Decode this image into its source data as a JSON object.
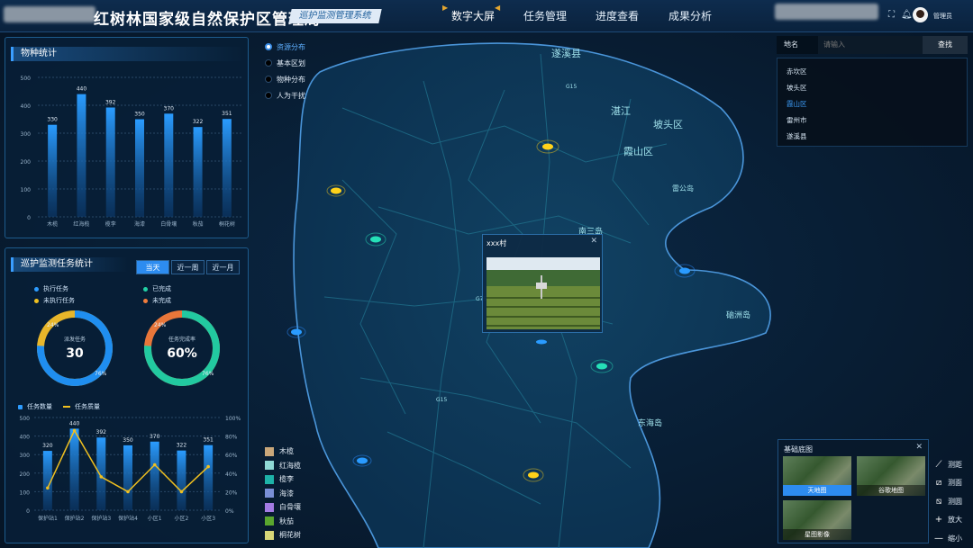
{
  "header": {
    "app_title": "红树林国家级自然保护区管理局",
    "system_badge": "巡护监测管理系统",
    "nav": [
      "数字大屏",
      "任务管理",
      "进度查看",
      "成果分析"
    ],
    "user_name": "管理员"
  },
  "species_panel": {
    "title": "物种统计",
    "chart_data": {
      "type": "bar",
      "categories": [
        "木榄",
        "红海榄",
        "榄李",
        "海漆",
        "白骨壤",
        "秋茄",
        "桐花树"
      ],
      "values": [
        330,
        440,
        392,
        350,
        370,
        322,
        351
      ],
      "ylim": [
        0,
        500
      ],
      "yticks": [
        "0",
        "100",
        "200",
        "300",
        "400",
        "500"
      ]
    }
  },
  "patrol_panel": {
    "title": "巡护监测任务统计",
    "tabs": [
      "当天",
      "近一周",
      "近一月"
    ],
    "legend1": [
      "执行任务",
      "未执行任务"
    ],
    "legend2": [
      "已完成",
      "未完成"
    ],
    "donut1": {
      "label": "派发任务",
      "value": "30",
      "pct_a": "24%",
      "pct_b": "76%",
      "fraction": 0.76
    },
    "donut2": {
      "label": "任务完成率",
      "value": "60%",
      "pct_a": "24%",
      "pct_b": "76%",
      "fraction": 0.76
    },
    "legend3": [
      "任务数量",
      "任务质量"
    ],
    "chart_data": {
      "type": "bar",
      "categories": [
        "保护站1",
        "保护站2",
        "保护站3",
        "保护站4",
        "小区1",
        "小区2",
        "小区3"
      ],
      "series": [
        {
          "name": "任务数量",
          "values": [
            320,
            440,
            392,
            350,
            370,
            322,
            351
          ]
        },
        {
          "name": "任务质量",
          "values": [
            24,
            86,
            36,
            20,
            49,
            20,
            47
          ]
        }
      ],
      "labels": [
        "320",
        "440",
        "392",
        "350",
        "370",
        "322",
        "351"
      ],
      "yticks_left": [
        "0",
        "100",
        "200",
        "300",
        "400",
        "500"
      ],
      "yticks_right": [
        "0%",
        "20%",
        "40%",
        "60%",
        "80%",
        "100%"
      ]
    }
  },
  "resource_menu": [
    "资源分布",
    "基本区划",
    "物种分布",
    "人为干扰"
  ],
  "search": {
    "label": "地名",
    "placeholder": "请输入",
    "button": "查找"
  },
  "districts": [
    "赤坎区",
    "坡头区",
    "霞山区",
    "雷州市",
    "遂溪县"
  ],
  "species_legend": [
    {
      "name": "木榄",
      "color": "#c9a77a"
    },
    {
      "name": "红海榄",
      "color": "#8fd9d6"
    },
    {
      "name": "榄李",
      "color": "#1eb3a8"
    },
    {
      "name": "海漆",
      "color": "#7a8fd6"
    },
    {
      "name": "白骨壤",
      "color": "#a47be3"
    },
    {
      "name": "秋茄",
      "color": "#5aa62e"
    },
    {
      "name": "桐花树",
      "color": "#d6d678"
    }
  ],
  "map_labels": [
    "遂溪县",
    "湛江",
    "坡头区",
    "霞山区",
    "雷公岛",
    "硇洲岛",
    "G15",
    "G15",
    "南三岛",
    "东海岛",
    "G75"
  ],
  "popup": {
    "title": "xxx村"
  },
  "basemap": {
    "title": "基础底图",
    "options": [
      "天地图",
      "谷歌地图",
      "星图影像"
    ]
  },
  "tools": [
    "测距",
    "测面",
    "测圆",
    "放大",
    "缩小"
  ]
}
